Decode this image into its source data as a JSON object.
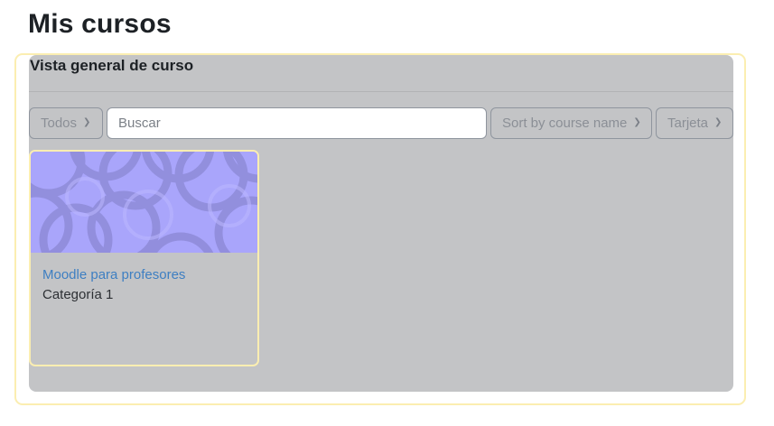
{
  "page": {
    "title": "Mis cursos"
  },
  "overview": {
    "title": "Vista general de curso",
    "filters": {
      "grouping": {
        "selected": "Todos",
        "icon": "chevron-down-icon"
      },
      "search": {
        "placeholder": "Buscar",
        "value": "",
        "icon": ""
      },
      "sort": {
        "selected": "Sort by course name",
        "icon": "chevron-down-icon"
      },
      "view": {
        "selected": "Tarjeta",
        "icon": "chevron-down-icon"
      }
    },
    "courses": [
      {
        "name": "Moodle para profesores",
        "category": "Categoría 1",
        "image": "course-pattern-image"
      }
    ]
  },
  "colors": {
    "panel_bg": "#c3c4c6",
    "focus_outline": "#fbeeb1",
    "course_image_bg": "#a9a5fb",
    "link": "#3e7fc2",
    "heading": "#1d2125"
  }
}
